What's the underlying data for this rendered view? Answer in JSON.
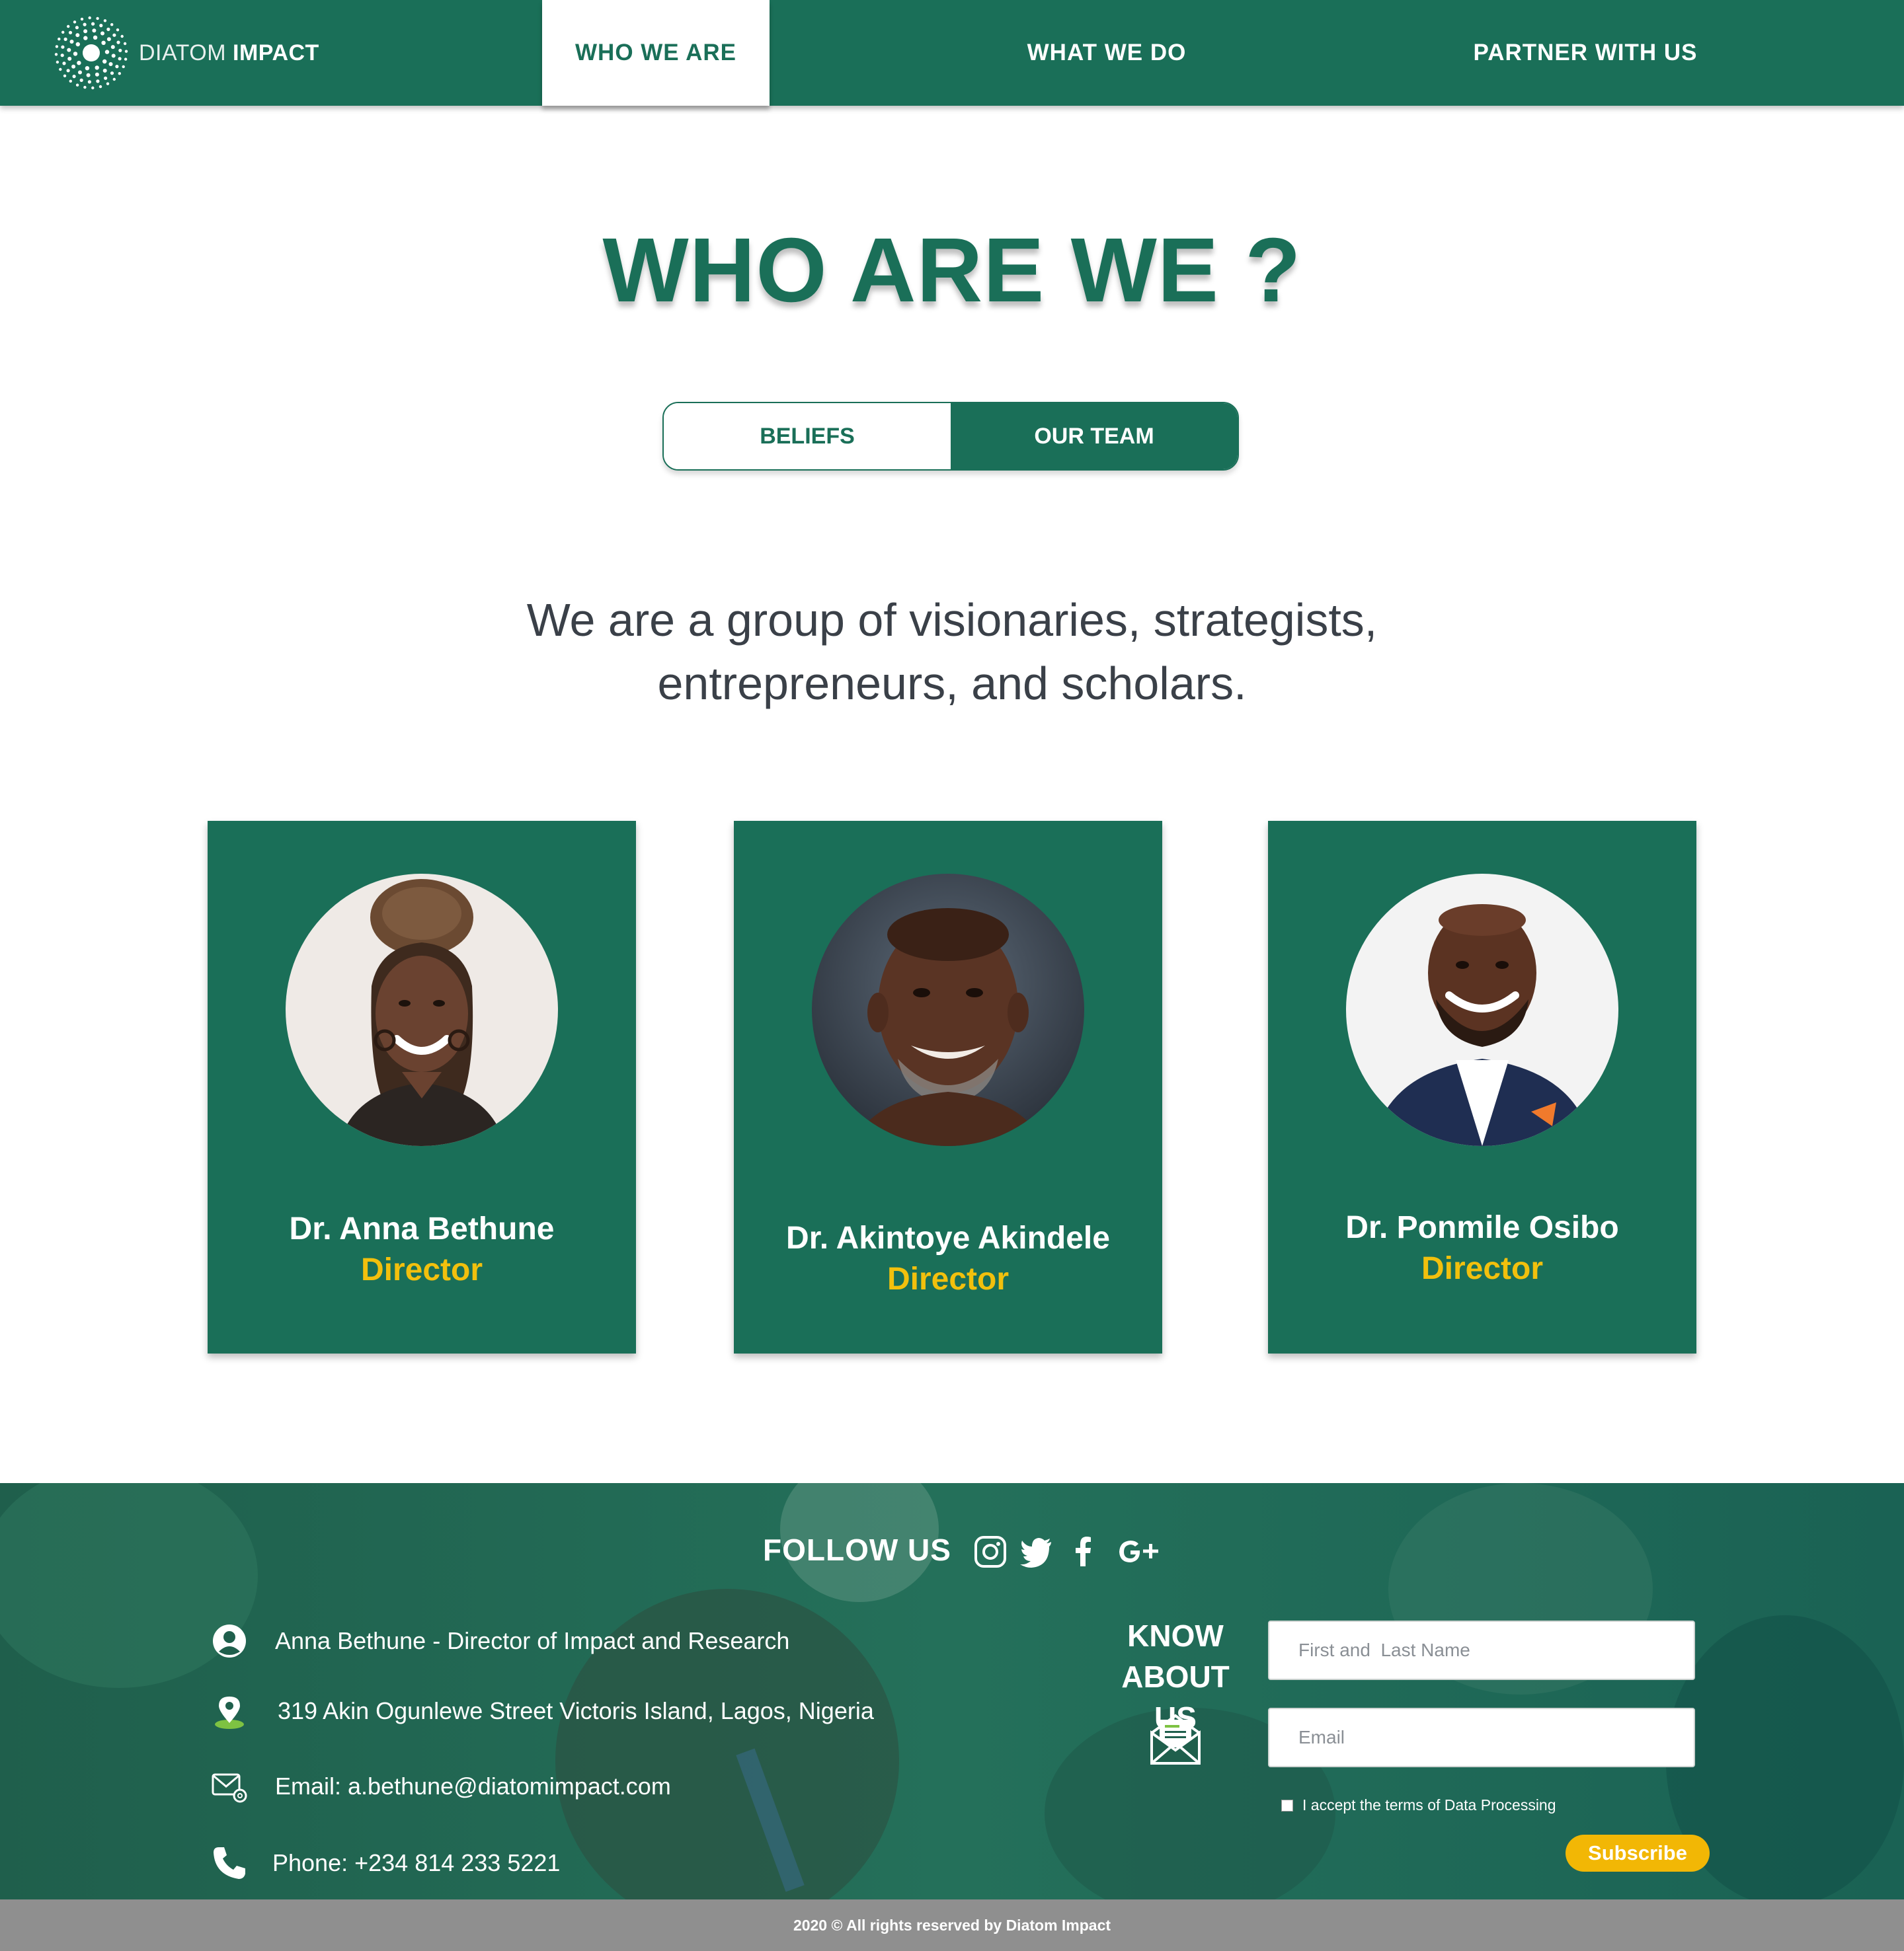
{
  "nav": {
    "logo": {
      "light": "DIATOM",
      "bold": "IMPACT"
    },
    "items": [
      {
        "label": "WHO WE ARE",
        "active": true
      },
      {
        "label": "WHAT WE DO",
        "active": false
      },
      {
        "label": "PARTNER WITH US",
        "active": false
      }
    ]
  },
  "hero": {
    "title": "WHO ARE WE ?",
    "toggle": {
      "beliefs": "BELIEFS",
      "team": "OUR TEAM",
      "selected": "OUR TEAM"
    },
    "intro_line1": "We are a group of visionaries, strategists,",
    "intro_line2": "entrepreneurs, and scholars."
  },
  "team": [
    {
      "name": "Dr. Anna Bethune",
      "role": "Director"
    },
    {
      "name": "Dr. Akintoye Akindele",
      "role": "Director"
    },
    {
      "name": "Dr. Ponmile Osibo",
      "role": "Director"
    }
  ],
  "footer": {
    "follow": "FOLLOW US",
    "social_icons": [
      "instagram-icon",
      "twitter-icon",
      "facebook-icon",
      "google-plus-icon"
    ],
    "contact": {
      "person": "Anna Bethune - Director of Impact and Research",
      "address": "319 Akin Ogunlewe Street Victoris Island, Lagos, Nigeria",
      "email": "Email: a.bethune@diatomimpact.com",
      "phone": "Phone: +234 814 233 5221"
    },
    "know_line1": "KNOW",
    "know_line2": "ABOUT US",
    "name_placeholder": "First and  Last Name",
    "email_placeholder": "Email",
    "terms": "I accept the terms of Data Processing",
    "subscribe": "Subscribe",
    "copyright": "2020 © All rights reserved by Diatom Impact"
  },
  "colors": {
    "brand_green": "#1a6f58",
    "accent_yellow": "#f2c00d",
    "button_yellow": "#f2b705",
    "footer_bar": "#8f8f8f"
  }
}
